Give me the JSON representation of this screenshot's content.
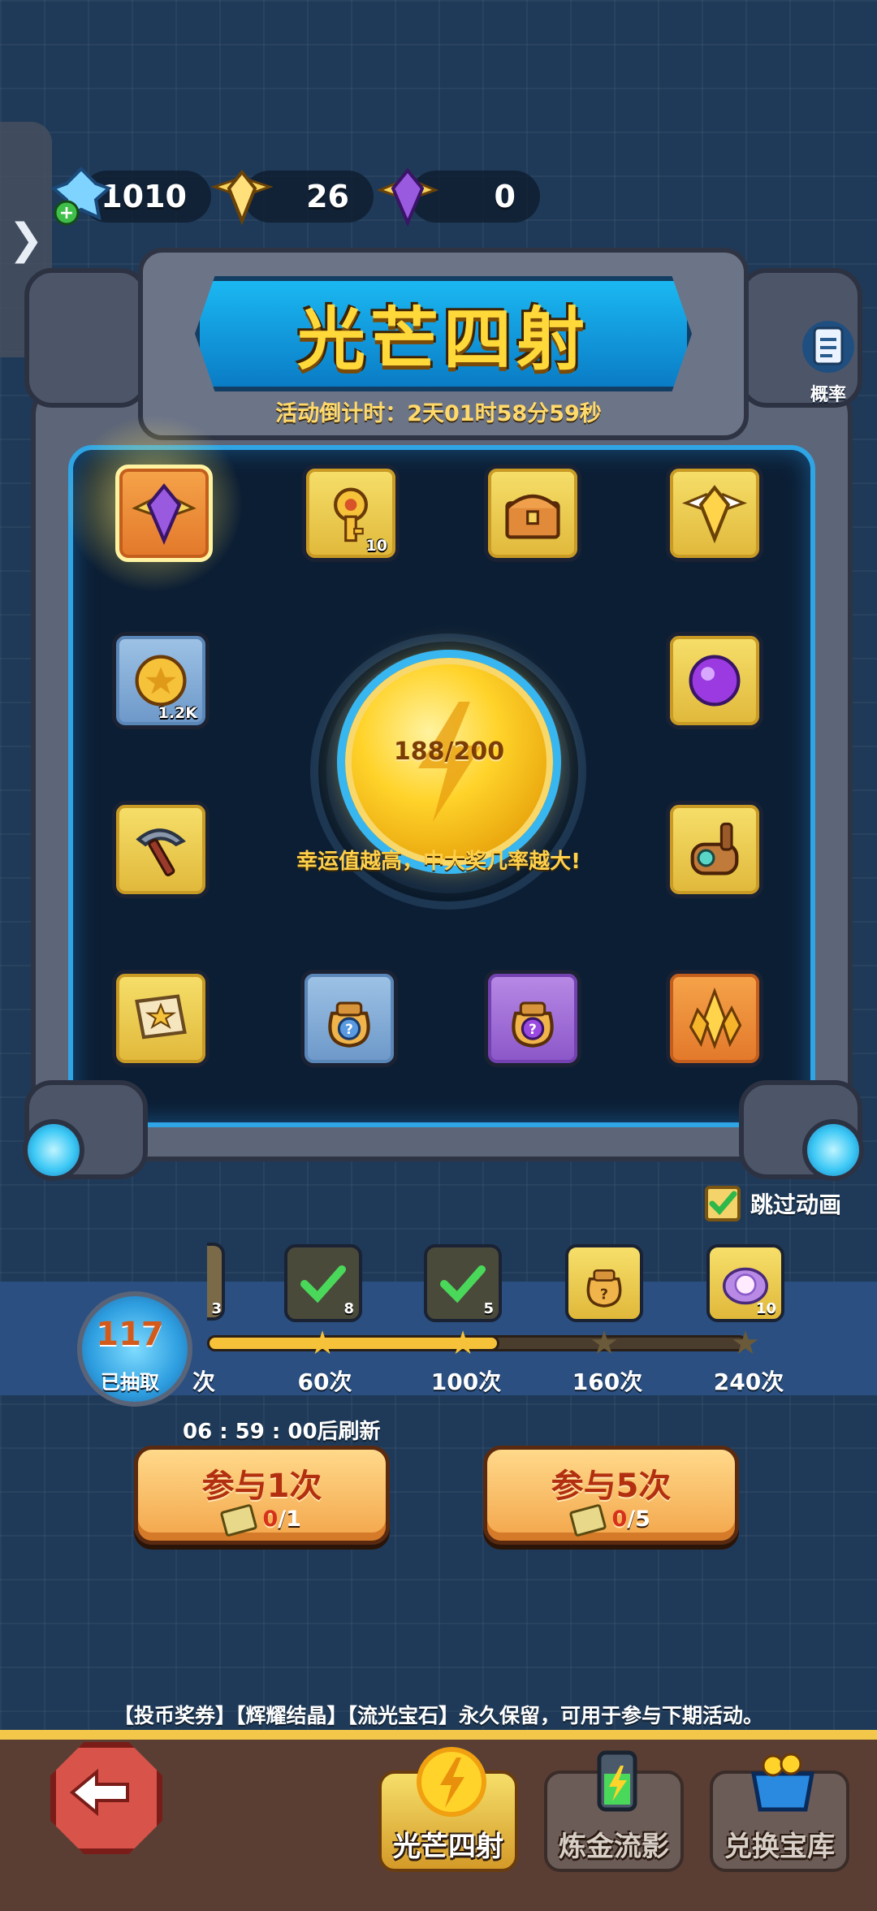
{
  "currencies": [
    {
      "icon": "blue-crystal-plus-icon",
      "value": "1010"
    },
    {
      "icon": "gold-winged-gem-icon",
      "value": "26"
    },
    {
      "icon": "purple-winged-gem-icon",
      "value": "0"
    }
  ],
  "side_tab": {
    "icon": "chevron-right-icon",
    "glyph": "❯"
  },
  "title": "光芒四射",
  "countdown": "活动倒计时：2天01时58分59秒",
  "probability_label": "概率",
  "tiles": [
    {
      "icon": "purple-winged-gem-icon",
      "count": ""
    },
    {
      "icon": "key-icon",
      "count": "10"
    },
    {
      "icon": "treasure-chest-icon",
      "count": ""
    },
    {
      "icon": "gold-winged-gem-icon",
      "count": ""
    },
    {
      "icon": "gold-coin-icon",
      "count": "1.2K"
    },
    {
      "icon": "purple-orb-icon",
      "count": ""
    },
    {
      "icon": "pickaxe-icon",
      "count": ""
    },
    {
      "icon": "scroll-device-icon",
      "count": ""
    },
    {
      "icon": "magic-scroll-icon",
      "count": ""
    },
    {
      "icon": "blue-mystery-bag-icon",
      "count": ""
    },
    {
      "icon": "purple-mystery-bag-icon",
      "count": ""
    },
    {
      "icon": "gold-crystal-cluster-icon",
      "count": ""
    }
  ],
  "luck": {
    "value": "188/200",
    "hint": "幸运值越高，中大奖几率越大!"
  },
  "skip_animation": {
    "label": "跳过动画",
    "checked": true
  },
  "progress": {
    "drawn_count": "117",
    "drawn_label": "已抽取",
    "milestones": [
      {
        "label": "60次",
        "reward_count": "8",
        "claimed": true
      },
      {
        "label": "100次",
        "reward_count": "5",
        "claimed": true
      },
      {
        "label": "160次",
        "reward_count": "",
        "claimed": false
      },
      {
        "label": "240次",
        "reward_count": "10",
        "claimed": false
      }
    ],
    "partial_left_count": "3",
    "partial_left_label": "次"
  },
  "refresh": "06 : 59 : 00后刷新",
  "buttons": [
    {
      "label": "参与1次",
      "cost_have": "0",
      "cost_need": "/1"
    },
    {
      "label": "参与5次",
      "cost_have": "0",
      "cost_need": "/5"
    }
  ],
  "notice": "【投币奖券】【辉耀结晶】【流光宝石】永久保留，可用于参与下期活动。",
  "nav": [
    {
      "label": "光芒四射",
      "active": true
    },
    {
      "label": "炼金流影",
      "active": false
    },
    {
      "label": "兑换宝库",
      "active": false
    }
  ],
  "colors": {
    "accent_gold": "#ffd93a",
    "frame_blue": "#2fa5e6",
    "button_orange": "#f3a54a"
  }
}
